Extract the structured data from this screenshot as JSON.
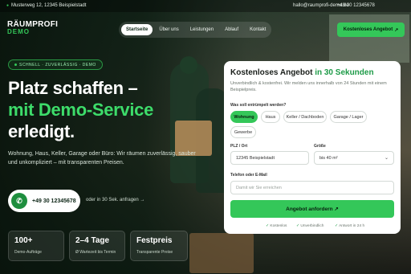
{
  "topbar": {
    "address": "Musterweg 12, 12345 Beispielstadt",
    "email": "hallo@raumprofi-demo.de",
    "phone": "+49 30 12345678"
  },
  "logo": {
    "line1": "RÄUMPROFI",
    "line2": "DEMO"
  },
  "nav": {
    "items": [
      "Startseite",
      "Über uns",
      "Leistungen",
      "Ablauf",
      "Kontakt"
    ],
    "active": "Startseite"
  },
  "header_cta": {
    "label": "Kostenloses Angebot",
    "icon": "arrow-icon"
  },
  "hero": {
    "badge": "SCHNELL · ZUVERLÄSSIG · DEMO",
    "headline_1": "Platz schaffen –",
    "headline_2": "mit Demo-Service",
    "headline_3": "erledigt.",
    "lead": "Wohnung, Haus, Keller, Garage oder Büro: Wir räumen zuverlässig, sauber und unkompliziert – mit transparenten Preisen.",
    "phone_button": "+49 30 12345678",
    "alt_cta": "oder in 30 Sek. anfragen →"
  },
  "stats": [
    {
      "value": "100+",
      "label": "Demo-Aufträge"
    },
    {
      "value": "2–4 Tage",
      "label": "Ø Wartezeit bis Termin"
    },
    {
      "value": "Festpreis",
      "label": "Transparente Preise"
    }
  ],
  "form": {
    "title_prefix": "Kostenloses Angebot",
    "title_highlight": "in 30 Sekunden",
    "subtitle": "Unverbindlich & kostenfrei. Wir melden uns innerhalb von 24 Stunden mit einem Beispielpreis.",
    "object_label": "Was soll entrümpelt werden?",
    "object_options": [
      "Wohnung",
      "Haus",
      "Keller / Dachboden",
      "Garage / Lager",
      "Gewerbe"
    ],
    "object_selected": "Wohnung",
    "zip_label": "PLZ / Ort",
    "zip_value": "12345 Beispielstadt",
    "size_label": "Größe",
    "size_value": "bis 40 m²",
    "contact_label": "Telefon oder E-Mail",
    "contact_placeholder": "Damit wir Sie erreichen",
    "submit": "Angebot anfordern ↗",
    "trust": [
      "Kostenlos",
      "Unverbindlich",
      "Antwort in 24 h"
    ]
  },
  "colors": {
    "accent": "#34c759",
    "accent_dark": "#1e9b48",
    "dark_bg": "#0d1a12"
  }
}
